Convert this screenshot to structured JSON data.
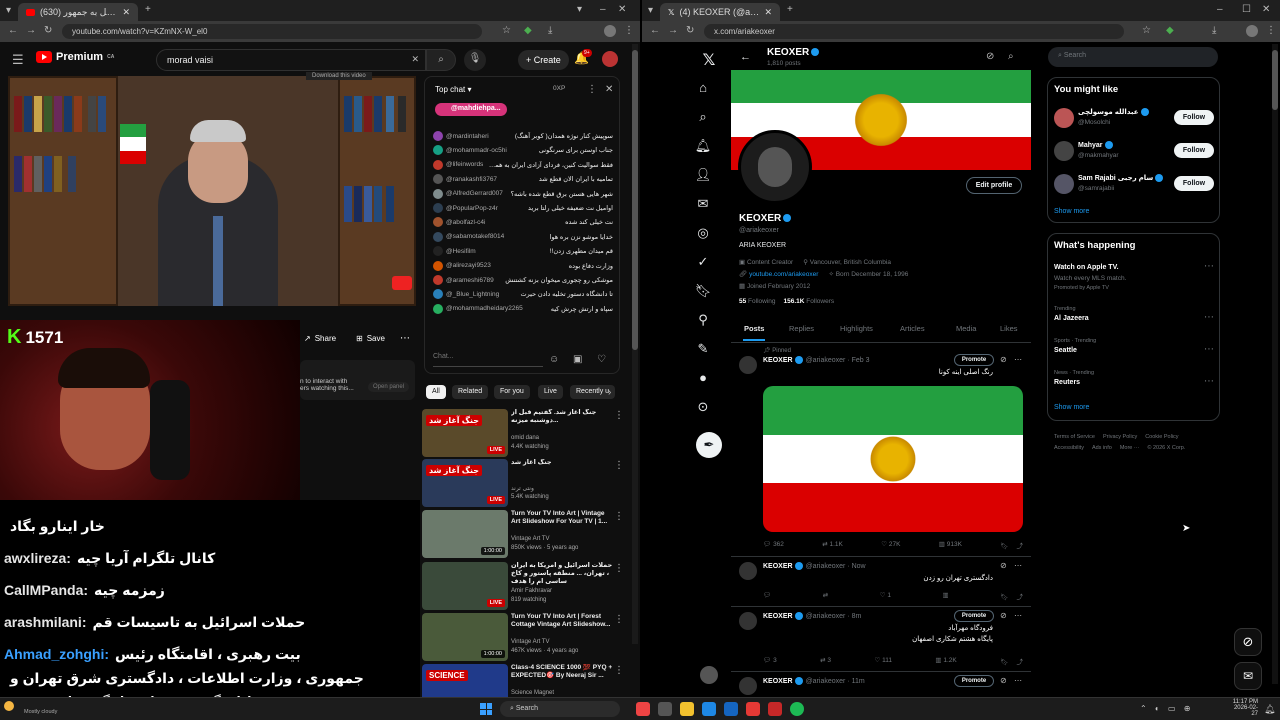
{
  "left_browser": {
    "tab_title": "(630) حمله اسرائیل به جمهور...",
    "url": "youtube.com/watch?v=KZmNX-W_el0"
  },
  "youtube": {
    "logo": "Premium",
    "logo_sup": "CA",
    "search_value": "morad vaisi",
    "create": "Create",
    "notif_count": "9+",
    "download_hint": "Download this video",
    "share": "Share",
    "save": "Save",
    "overlay_text_1": "n to interact with",
    "overlay_text_2": "ers watching this...",
    "open_panel": "Open panel"
  },
  "live_chat": {
    "title": "Top chat",
    "xp": "0XP",
    "pinned_user": "@mahdiehpa...",
    "placeholder": "Chat...",
    "messages": [
      {
        "user": "@mardintaheri",
        "text": "سوپیش کنار نوژه همدان( کوبر آهنگ)",
        "color": "#8e44ad"
      },
      {
        "user": "@mohammadr-oc5hi",
        "text": "جناب اوستن برای سرنگونی",
        "color": "#16a085"
      },
      {
        "user": "@lifeinwords",
        "text": "فقط سوالیت کنین، فردای آزادی ایران به همه شما نیاز داریم ❤️",
        "color": "#c0392b"
      },
      {
        "user": "@ranakashfi3767",
        "text": "تمامیه با ایران الان قطع شد",
        "color": "#555"
      },
      {
        "user": "@AlfredGerrard007",
        "text": "شهر هایی هستن برق قطع شده باشه؟",
        "color": "#7f8c8d"
      },
      {
        "user": "@PopularPop-z4r",
        "text": "اوامیل نت ضعیفه خیلی رلتا برید",
        "color": "#2c3e50"
      },
      {
        "user": "@abolfazl-c4i",
        "text": "نت خیلی کند شده",
        "color": "#a0522d"
      },
      {
        "user": "@sabamotakef8014",
        "text": "خدایا موشو نزن بره هوا",
        "color": "#34495e"
      },
      {
        "user": "@Hesifilm",
        "text": "قم میدان مطهری زدن!!",
        "color": "#222"
      },
      {
        "user": "@alirezayi9523",
        "text": "وزارت دفاع بوده",
        "color": "#d35400"
      },
      {
        "user": "@arameshi6789",
        "text": "موشکی رو چجوری میخوان بزنه کشتنش",
        "color": "#c0392b"
      },
      {
        "user": "@_Blue_Lightning",
        "text": "تا دانشگاه دستور تخلیه دادن حیرت",
        "color": "#2980b9"
      },
      {
        "user": "@mohammadheidary2265",
        "text": "سپاه و ارتش چرش کیه",
        "color": "#27ae60"
      }
    ]
  },
  "recommendations": {
    "chips": [
      "All",
      "Related",
      "For you",
      "Live",
      "Recently u"
    ],
    "items": [
      {
        "title": "جنگ آغاز شد. گفتیم قبل از دوشنبه میزنه...",
        "channel": "omid dana",
        "meta": "4.4K watching",
        "live": "LIVE",
        "thumb_text": "جنگ آغاز شد"
      },
      {
        "title": "جنگ آغاز شد",
        "channel": "ونتی ترند",
        "meta": "5.4K watching",
        "live": "LIVE",
        "thumb_text": "جنگ آغاز شد"
      },
      {
        "title": "Turn Your TV Into Art | Vintage Art Slideshow For Your TV | 1...",
        "channel": "Vintage Art TV",
        "meta": "850K views · 5 years ago",
        "duration": "1:00:00"
      },
      {
        "title": "حملات اسرائیل و آمریکا به ایران ، تهران، ... منطقه پاستور و کاخ ساسی ام را هدف",
        "channel": "Amir Fakhravar",
        "meta": "819 watching",
        "live": "LIVE"
      },
      {
        "title": "Turn Your TV Into Art | Forest Cottage Vintage Art Slideshow...",
        "channel": "Vintage Art TV",
        "meta": "467K views · 4 years ago",
        "duration": "1:00:00"
      },
      {
        "title": "Class-4 SCIENCE 1000 💯 PYQ + EXPECTED🎯 By Neeraj Sir ...",
        "channel": "Science Magnet",
        "meta": "",
        "thumb_text": "SCIENCE"
      }
    ]
  },
  "stream": {
    "kick_count": "1571",
    "chat": [
      {
        "user": "",
        "text": "خار اینارو بگاد",
        "user_color": "#fff"
      },
      {
        "user": "awxlireza:",
        "text": "کانال تلگرام آریا چیه",
        "user_color": "#e6e6e6"
      },
      {
        "user": "CallMPanda:",
        "text": "زمزمه چیه",
        "user_color": "#e6e6e6"
      },
      {
        "user": "arashmilani:",
        "text": "حملات اسرائیل به تاسیسات قم",
        "user_color": "#e6e6e6"
      },
      {
        "user": "Ahmad_zohghi:",
        "text": "بیت رهبری ، اقامتگاه رئیس",
        "user_color": "#3aa0ff"
      },
      {
        "user": "",
        "text": "جمهوری ، وزارت اطلاعات ، دادگستری شرق تهران و",
        "user_color": "#fff"
      },
      {
        "user": "",
        "text": "چندین نقاط دیگر مورد حمله قرار گرفته است.",
        "user_color": "#fff"
      }
    ]
  },
  "right_browser": {
    "tab_title": "(4) KEOXER (@ariakeoxer) / X",
    "url": "x.com/ariakeoxer"
  },
  "x_profile": {
    "header_name": "KEOXER",
    "posts_count": "1,810 posts",
    "name": "KEOXER",
    "handle": "@ariakeoxer",
    "bio": "ARIA KEOXER",
    "category": "Content Creator",
    "location": "Vancouver, British Columbia",
    "link": "youtube.com/ariakeoxer",
    "born": "Born December 18, 1996",
    "joined": "Joined February 2012",
    "following": "55",
    "following_label": "Following",
    "followers": "156.1K",
    "followers_label": "Followers",
    "edit_profile": "Edit profile",
    "tabs": [
      "Posts",
      "Replies",
      "Highlights",
      "Articles",
      "Media",
      "Likes"
    ],
    "pinned": "Pinned",
    "posts": [
      {
        "name": "KEOXER",
        "handle": "@ariakeoxer · Feb 3",
        "text": "رنگ اصلی اینه کونا",
        "promote": "Promote",
        "replies": "362",
        "reposts": "1.1K",
        "likes": "27K",
        "views": "913K"
      },
      {
        "name": "KEOXER",
        "handle": "@ariakeoxer · Now",
        "text": "دادگستری تهران رو زدن",
        "promote": "",
        "replies": "",
        "reposts": "",
        "likes": "1",
        "views": ""
      },
      {
        "name": "KEOXER",
        "handle": "@ariakeoxer · 8m",
        "text": "فرودگاه مهرآباد",
        "text2": "پایگاه هشتم شکاری اصفهان",
        "promote": "Promote",
        "replies": "3",
        "reposts": "3",
        "likes": "111",
        "views": "1.2K"
      },
      {
        "name": "KEOXER",
        "handle": "@ariakeoxer · 11m",
        "text": "",
        "promote": "Promote"
      }
    ]
  },
  "x_sidebar": {
    "search_placeholder": "Search",
    "might_like_title": "You might like",
    "suggestions": [
      {
        "name": "عبدالله موسولچی",
        "handle": "@Mosolchi",
        "button": "Follow"
      },
      {
        "name": "Mahyar",
        "handle": "@makmahyar",
        "button": "Follow"
      },
      {
        "name": "Sam Rajabi سام رجبی",
        "handle": "@samrajabii",
        "button": "Follow"
      }
    ],
    "show_more": "Show more",
    "happening_title": "What's happening",
    "trends": [
      {
        "context": "",
        "topic": "Watch on Apple TV.",
        "desc": "Watch every MLS match.",
        "promo": "Promoted by Apple TV"
      },
      {
        "context": "Trending",
        "topic": "Al Jazeera"
      },
      {
        "context": "Sports · Trending",
        "topic": "Seattle"
      },
      {
        "context": "News · Trending",
        "topic": "Reuters"
      }
    ],
    "footer": [
      "Terms of Service",
      "Privacy Policy",
      "Cookie Policy",
      "Accessibility",
      "Ads info",
      "More ···",
      "© 2026 X Corp."
    ]
  },
  "taskbar": {
    "weather": "Mostly cloudy",
    "search": "Search",
    "time": "11:17 PM",
    "date": "2026-02-27"
  }
}
